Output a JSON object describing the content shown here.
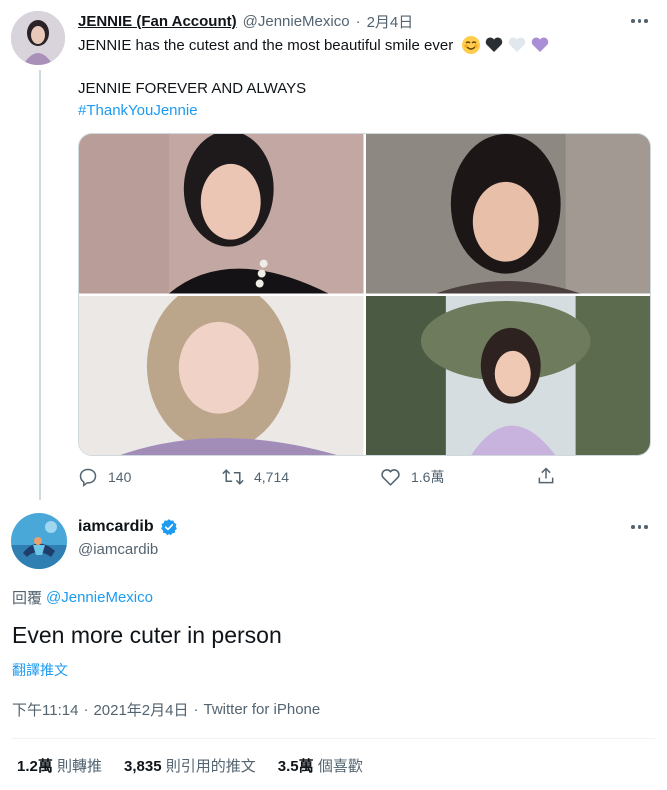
{
  "parent_tweet": {
    "display_name": "JENNIE (Fan Account)",
    "handle": "@JennieMexico",
    "separator": "·",
    "date": "2月4日",
    "line1": "JENNIE has the cutest and the most beautiful smile ever",
    "line2": "JENNIE FOREVER AND ALWAYS",
    "hashtag": "#ThankYouJennie",
    "actions": {
      "replies": "140",
      "retweets": "4,714",
      "likes": "1.6萬"
    }
  },
  "reply_tweet": {
    "display_name": "iamcardib",
    "handle": "@iamcardib",
    "reply_prefix": "回覆",
    "reply_to": "@JennieMexico",
    "text": "Even more cuter in person",
    "translate": "翻譯推文",
    "meta_time": "下午11:14",
    "meta_sep": "·",
    "meta_date": "2021年2月4日",
    "meta_source": "Twitter for iPhone"
  },
  "stats": [
    {
      "value": "1.2萬",
      "label": "則轉推"
    },
    {
      "value": "3,835",
      "label": "則引用的推文"
    },
    {
      "value": "3.5萬",
      "label": "個喜歡"
    }
  ],
  "colors": {
    "accent": "#1d9bf0",
    "text": "#0f1419",
    "muted": "#536471",
    "border": "#cfd9de"
  }
}
